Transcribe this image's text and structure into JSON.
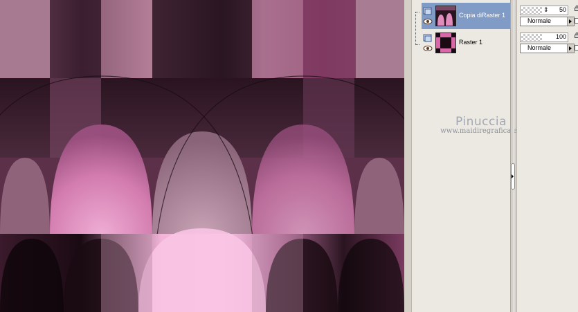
{
  "layers_panel": {
    "layers": [
      {
        "name": "Copia diRaster 1",
        "selected": true,
        "opacity": "50",
        "blend_mode": "Normale"
      },
      {
        "name": "Raster 1",
        "selected": false,
        "opacity": "100",
        "blend_mode": "Normale"
      }
    ]
  },
  "watermark": {
    "name": "Pinuccia",
    "url": "www.maidiregrafica.eu"
  },
  "icons": {
    "visibility": "eye-icon",
    "layer_type": "raster-layer-icon",
    "lock": "lock-icon",
    "collapse": "chevron-right-icon"
  },
  "colors": {
    "selection": "#7f9bc6",
    "panel": "#ece9e2",
    "chrome": "#d4d0c8"
  }
}
